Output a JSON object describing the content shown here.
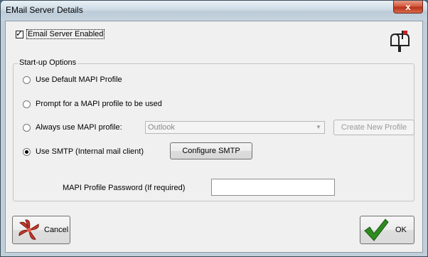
{
  "window": {
    "title": "EMail Server Details",
    "close_glyph": "x"
  },
  "email_enabled": {
    "label": "Email Server Enabled",
    "checked": true,
    "check_glyph": "✓"
  },
  "icons": {
    "mailbox": "mailbox-icon",
    "cancel": "red-pinwheel-icon",
    "ok": "green-checkmark-icon"
  },
  "startup": {
    "legend": "Start-up Options",
    "options": [
      {
        "label": "Use Default MAPI Profile",
        "selected": false
      },
      {
        "label": "Prompt for a MAPI profile to be used",
        "selected": false
      },
      {
        "label": "Always use MAPI profile:",
        "selected": false
      },
      {
        "label": "Use SMTP (Internal mail client)",
        "selected": true
      }
    ],
    "profile_combo_value": "Outlook",
    "create_profile_label": "Create New Profile",
    "configure_smtp_label": "Configure SMTP"
  },
  "password": {
    "label": "MAPI Profile Password (If required)",
    "value": ""
  },
  "buttons": {
    "cancel": "Cancel",
    "ok": "OK"
  },
  "colors": {
    "cancel_icon": "#c0392b",
    "ok_icon": "#2e8b1e"
  }
}
